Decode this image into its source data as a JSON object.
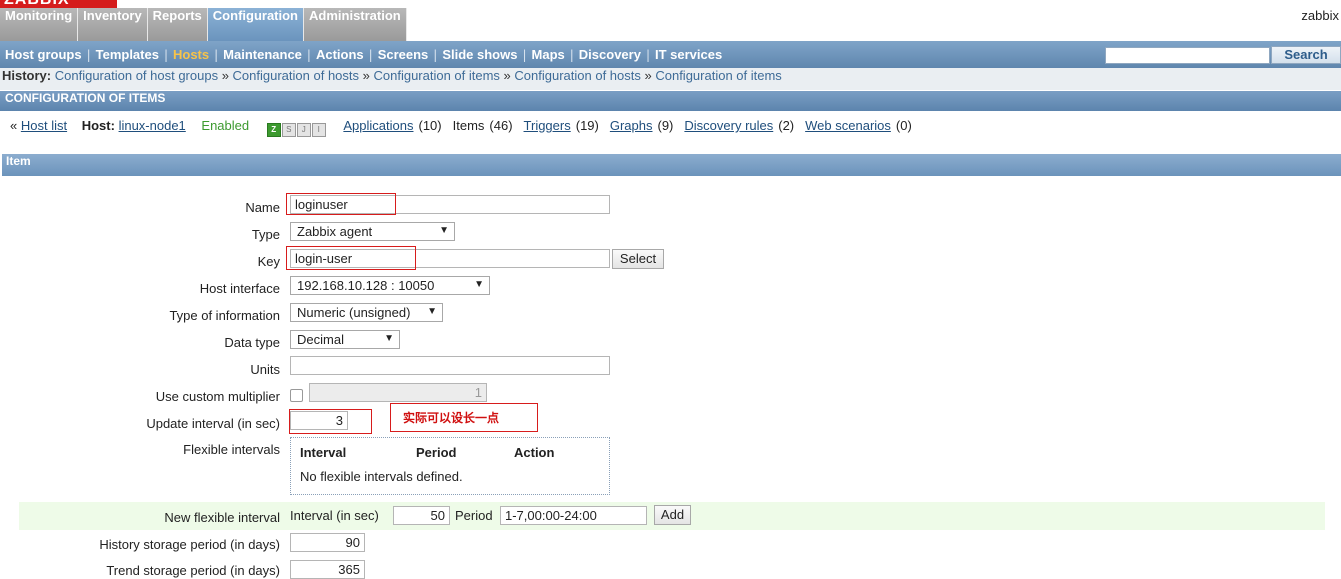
{
  "brand": {
    "logo_text": "ZABBIX",
    "user": "zabbix"
  },
  "topnav": {
    "tabs": [
      {
        "label": "Monitoring"
      },
      {
        "label": "Inventory"
      },
      {
        "label": "Reports"
      },
      {
        "label": "Configuration",
        "active": true
      },
      {
        "label": "Administration"
      }
    ]
  },
  "subnav": {
    "items": [
      {
        "label": "Host groups"
      },
      {
        "label": "Templates"
      },
      {
        "label": "Hosts",
        "active": true
      },
      {
        "label": "Maintenance"
      },
      {
        "label": "Actions"
      },
      {
        "label": "Screens"
      },
      {
        "label": "Slide shows"
      },
      {
        "label": "Maps"
      },
      {
        "label": "Discovery"
      },
      {
        "label": "IT services"
      }
    ],
    "search_button": "Search"
  },
  "history": {
    "label": "History:",
    "crumbs": [
      "Configuration of host groups",
      "Configuration of hosts",
      "Configuration of items",
      "Configuration of hosts",
      "Configuration of items"
    ]
  },
  "page_title": "CONFIGURATION OF ITEMS",
  "hostbar": {
    "host_list": "Host list",
    "host_label": "Host:",
    "host_name": "linux-node1",
    "status": "Enabled",
    "availability_icons": [
      "Z",
      "S",
      "J",
      "I"
    ],
    "links": [
      {
        "label": "Applications",
        "count": "(10)",
        "link": true
      },
      {
        "label": "Items",
        "count": "(46)",
        "link": false
      },
      {
        "label": "Triggers",
        "count": "(19)",
        "link": true
      },
      {
        "label": "Graphs",
        "count": "(9)",
        "link": true
      },
      {
        "label": "Discovery rules",
        "count": "(2)",
        "link": true
      },
      {
        "label": "Web scenarios",
        "count": "(0)",
        "link": true
      }
    ]
  },
  "form": {
    "section_title": "Item",
    "name": {
      "label": "Name",
      "value": "loginuser"
    },
    "type": {
      "label": "Type",
      "value": "Zabbix agent"
    },
    "key": {
      "label": "Key",
      "value": "login-user",
      "select_button": "Select"
    },
    "host_interface": {
      "label": "Host interface",
      "value": "192.168.10.128 : 10050"
    },
    "type_of_information": {
      "label": "Type of information",
      "value": "Numeric (unsigned)"
    },
    "data_type": {
      "label": "Data type",
      "value": "Decimal"
    },
    "units": {
      "label": "Units",
      "value": ""
    },
    "custom_multiplier": {
      "label": "Use custom multiplier",
      "value": "1"
    },
    "update_interval": {
      "label": "Update interval (in sec)",
      "value": "3"
    },
    "annotation": "实际可以设长一点",
    "flexible_intervals": {
      "label": "Flexible intervals",
      "columns": [
        "Interval",
        "Period",
        "Action"
      ],
      "empty_message": "No flexible intervals defined."
    },
    "new_flexible_interval": {
      "label": "New flexible interval",
      "interval_label": "Interval (in sec)",
      "interval_value": "50",
      "period_label": "Period",
      "period_value": "1-7,00:00-24:00",
      "add_button": "Add"
    },
    "history_period": {
      "label": "History storage period (in days)",
      "value": "90"
    },
    "trend_period": {
      "label": "Trend storage period (in days)",
      "value": "365"
    }
  }
}
